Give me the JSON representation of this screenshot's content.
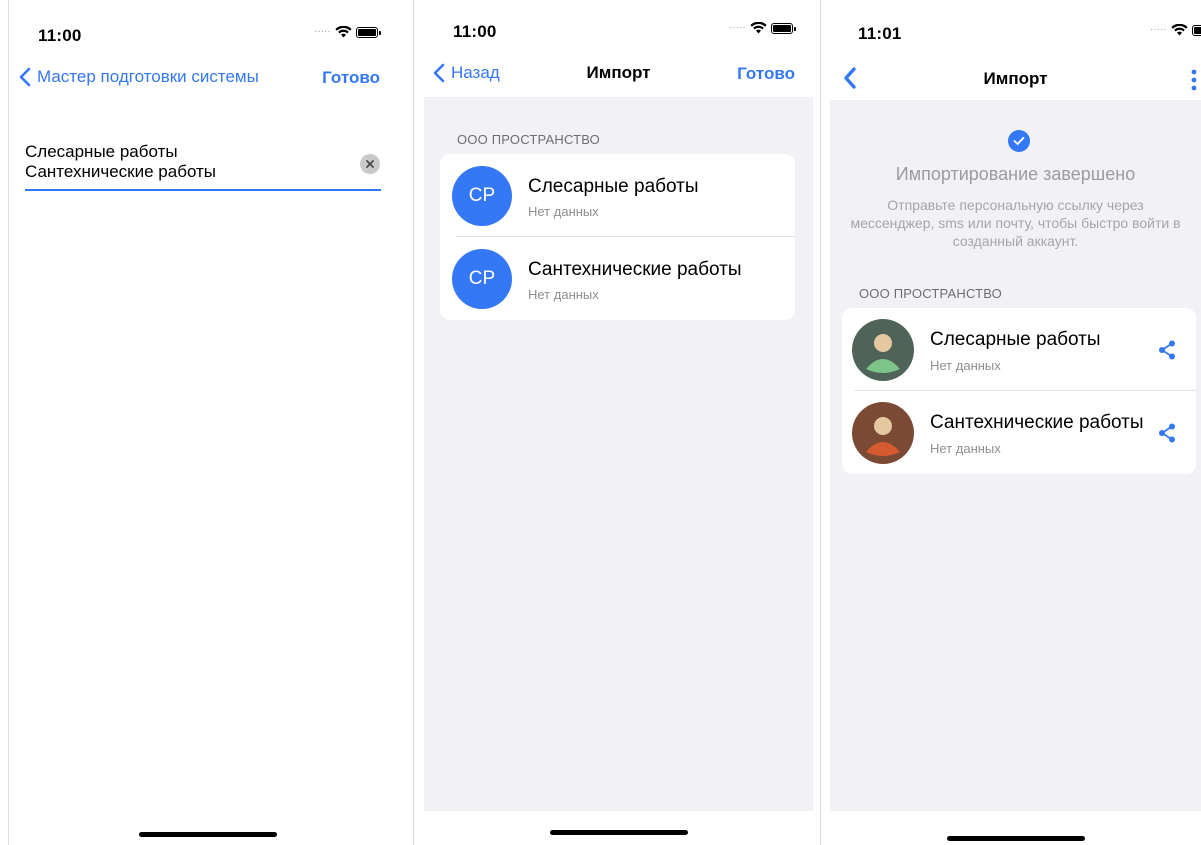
{
  "colors": {
    "accent": "#3478f6",
    "group_bg": "#f2f2f6"
  },
  "screen1": {
    "time": "11:00",
    "back_label": "Мастер подготовки системы",
    "done_label": "Готово",
    "text_lines": [
      "Слесарные работы",
      "Сантехнические работы"
    ]
  },
  "screen2": {
    "time": "11:00",
    "back_label": "Назад",
    "title": "Импорт",
    "done_label": "Готово",
    "section": "ООО ПРОСТРАНСТВО",
    "items": [
      {
        "initials": "СР",
        "title": "Слесарные работы",
        "subtitle": "Нет данных"
      },
      {
        "initials": "СР",
        "title": "Сантехнические работы",
        "subtitle": "Нет данных"
      }
    ]
  },
  "screen3": {
    "time": "11:01",
    "title": "Импорт",
    "done_title": "Импортирование завершено",
    "done_desc": "Отправьте персональную ссылку через мессенджер, sms или почту, чтобы быстро войти в созданный аккаунт.",
    "section": "ООО ПРОСТРАНСТВО",
    "items": [
      {
        "title": "Слесарные работы",
        "subtitle": "Нет данных",
        "avatar_bg": "#4f6358",
        "avatar_body": "#7cc48a"
      },
      {
        "title": "Сантехнические работы",
        "subtitle": "Нет данных",
        "avatar_bg": "#7a4a35",
        "avatar_body": "#d65a2f"
      }
    ]
  }
}
